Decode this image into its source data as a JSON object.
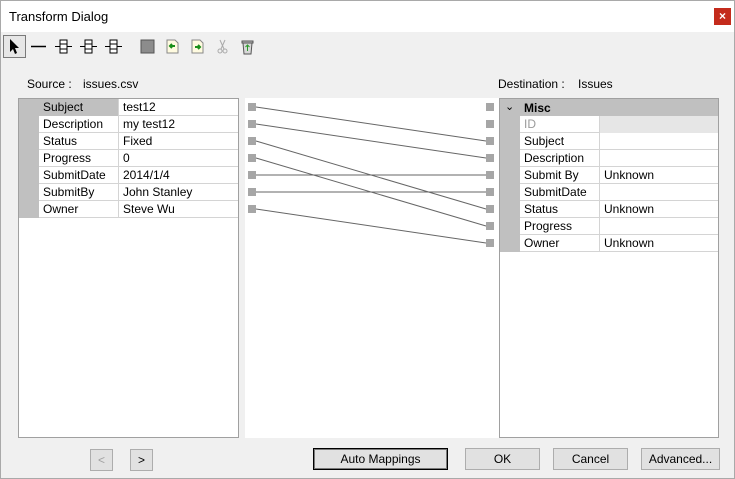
{
  "window": {
    "title": "Transform Dialog"
  },
  "toolbar": {
    "items": [
      {
        "name": "pointer-tool",
        "icon": "pointer-icon"
      },
      {
        "name": "line-tool",
        "icon": "line-icon"
      },
      {
        "name": "connect-tool-1",
        "icon": "connector-icon"
      },
      {
        "name": "connect-tool-2",
        "icon": "connector-icon"
      },
      {
        "name": "connect-tool-3",
        "icon": "connector-icon"
      },
      {
        "name": "block-tool",
        "icon": "block-icon"
      },
      {
        "name": "import-tool",
        "icon": "import-icon"
      },
      {
        "name": "export-tool",
        "icon": "export-icon"
      },
      {
        "name": "cut-tool",
        "icon": "scissors-icon"
      },
      {
        "name": "delete-tool",
        "icon": "recycle-bin-icon"
      }
    ]
  },
  "source": {
    "label": "Source :",
    "name": "issues.csv",
    "rows": [
      {
        "field": "Subject",
        "value": "test12"
      },
      {
        "field": "Description",
        "value": "my test12"
      },
      {
        "field": "Status",
        "value": "Fixed"
      },
      {
        "field": "Progress",
        "value": "0"
      },
      {
        "field": "SubmitDate",
        "value": "2014/1/4"
      },
      {
        "field": "SubmitBy",
        "value": "John Stanley"
      },
      {
        "field": "Owner",
        "value": "Steve Wu"
      }
    ]
  },
  "destination": {
    "label": "Destination :",
    "name": "Issues",
    "group": "Misc",
    "rows": [
      {
        "field": "ID",
        "value": ""
      },
      {
        "field": "Subject",
        "value": ""
      },
      {
        "field": "Description",
        "value": ""
      },
      {
        "field": "Submit By",
        "value": "Unknown"
      },
      {
        "field": "SubmitDate",
        "value": ""
      },
      {
        "field": "Status",
        "value": "Unknown"
      },
      {
        "field": "Progress",
        "value": ""
      },
      {
        "field": "Owner",
        "value": "Unknown"
      }
    ]
  },
  "mappings": [
    {
      "from": "Subject",
      "to": "Subject"
    },
    {
      "from": "Description",
      "to": "Description"
    },
    {
      "from": "Status",
      "to": "Status"
    },
    {
      "from": "Progress",
      "to": "Progress"
    },
    {
      "from": "SubmitDate",
      "to": "Submit By"
    },
    {
      "from": "SubmitBy",
      "to": "SubmitDate"
    },
    {
      "from": "Owner",
      "to": "Owner"
    }
  ],
  "buttons": {
    "prev": "<",
    "next": ">",
    "auto_mappings": "Auto Mappings",
    "ok": "OK",
    "cancel": "Cancel",
    "advanced": "Advanced..."
  }
}
